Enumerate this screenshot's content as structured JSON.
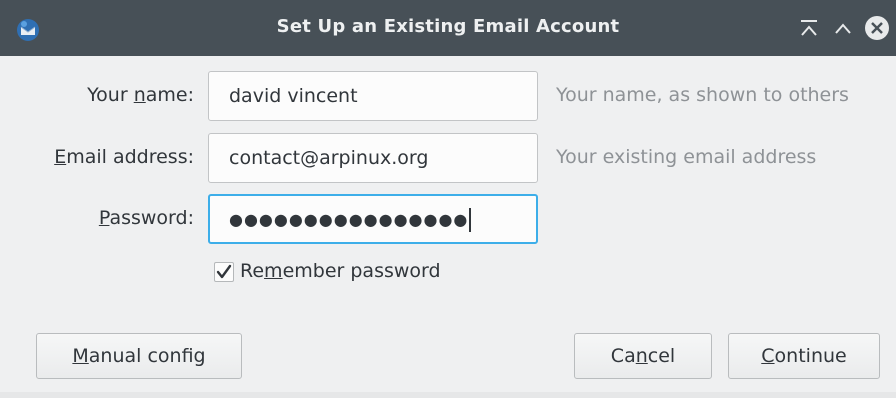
{
  "window": {
    "title": "Set Up an Existing Email Account",
    "app_icon": "thunderbird-icon",
    "controls": {
      "keep_above_icon": "keep-above-icon",
      "maximize_icon": "chevron-up-icon",
      "close_icon": "close-icon"
    }
  },
  "form": {
    "name": {
      "label_pre": "Your ",
      "label_mnemonic": "n",
      "label_post": "ame:",
      "value": "david vincent",
      "hint": "Your name, as shown to others"
    },
    "email": {
      "label_pre": "",
      "label_mnemonic": "E",
      "label_post": "mail address:",
      "value": "contact@arpinux.org",
      "hint": "Your existing email address"
    },
    "password": {
      "label_pre": "",
      "label_mnemonic": "P",
      "label_post": "assword:",
      "value": "●●●●●●●●●●●●●●●●"
    },
    "remember": {
      "label_pre": "Re",
      "label_mnemonic": "m",
      "label_post": "ember password",
      "checked": true
    }
  },
  "buttons": {
    "manual": {
      "pre": "",
      "mnemonic": "M",
      "post": "anual config"
    },
    "cancel": {
      "pre": "Ca",
      "mnemonic": "n",
      "post": "cel"
    },
    "continue": {
      "pre": "",
      "mnemonic": "C",
      "post": "ontinue"
    }
  },
  "colors": {
    "titlebar": "#475057",
    "background": "#eff0f1",
    "focus": "#3daee9",
    "hint_text": "#8e9296"
  }
}
